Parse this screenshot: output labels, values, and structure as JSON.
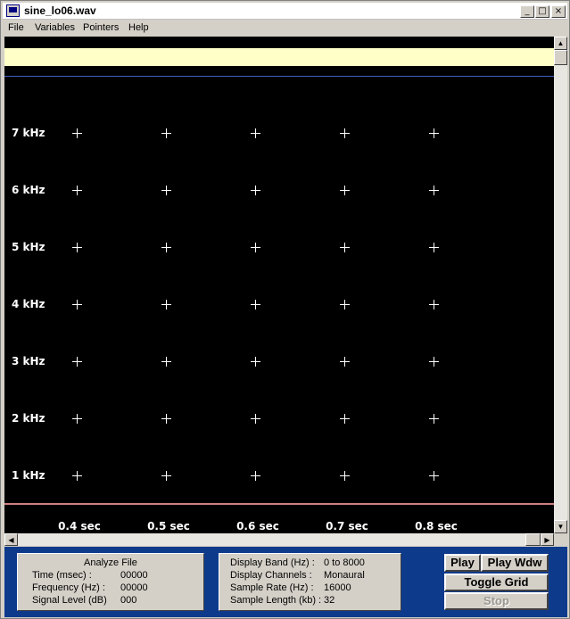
{
  "window": {
    "title": "sine_lo06.wav"
  },
  "titlebar": {
    "minimize": "_",
    "maximize": "□",
    "close": "×"
  },
  "menu": [
    "File",
    "Variables",
    "Pointers",
    "Help"
  ],
  "spectrogram": {
    "freq_labels": [
      "7  kHz",
      "6  kHz",
      "5  kHz",
      "4  kHz",
      "3  kHz",
      "2  kHz",
      "1  kHz"
    ],
    "time_labels": [
      "0.4 sec",
      "0.5 sec",
      "0.6 sec",
      "0.7 sec",
      "0.8 sec"
    ]
  },
  "analyze": {
    "title": "Analyze File",
    "time_label": "Time (msec) :",
    "time_value": "00000",
    "freq_label": "Frequency (Hz) :",
    "freq_value": "00000",
    "level_label": "Signal Level (dB)",
    "level_value": "000"
  },
  "display": {
    "band_label": "Display Band (Hz) :",
    "band_value": "0 to 8000",
    "channels_label": "Display Channels :",
    "channels_value": "Monaural",
    "rate_label": "Sample Rate (Hz) :",
    "rate_value": "16000",
    "length_label": "Sample Length (kb) :",
    "length_value": "32"
  },
  "controls": {
    "play": "Play",
    "play_wdw": "Play Wdw",
    "toggle_grid": "Toggle Grid",
    "stop": "Stop"
  },
  "colors": {
    "plot_background": "#000000",
    "cursor_band": "#ffffc8",
    "panel_background": "#0e3a8c"
  }
}
